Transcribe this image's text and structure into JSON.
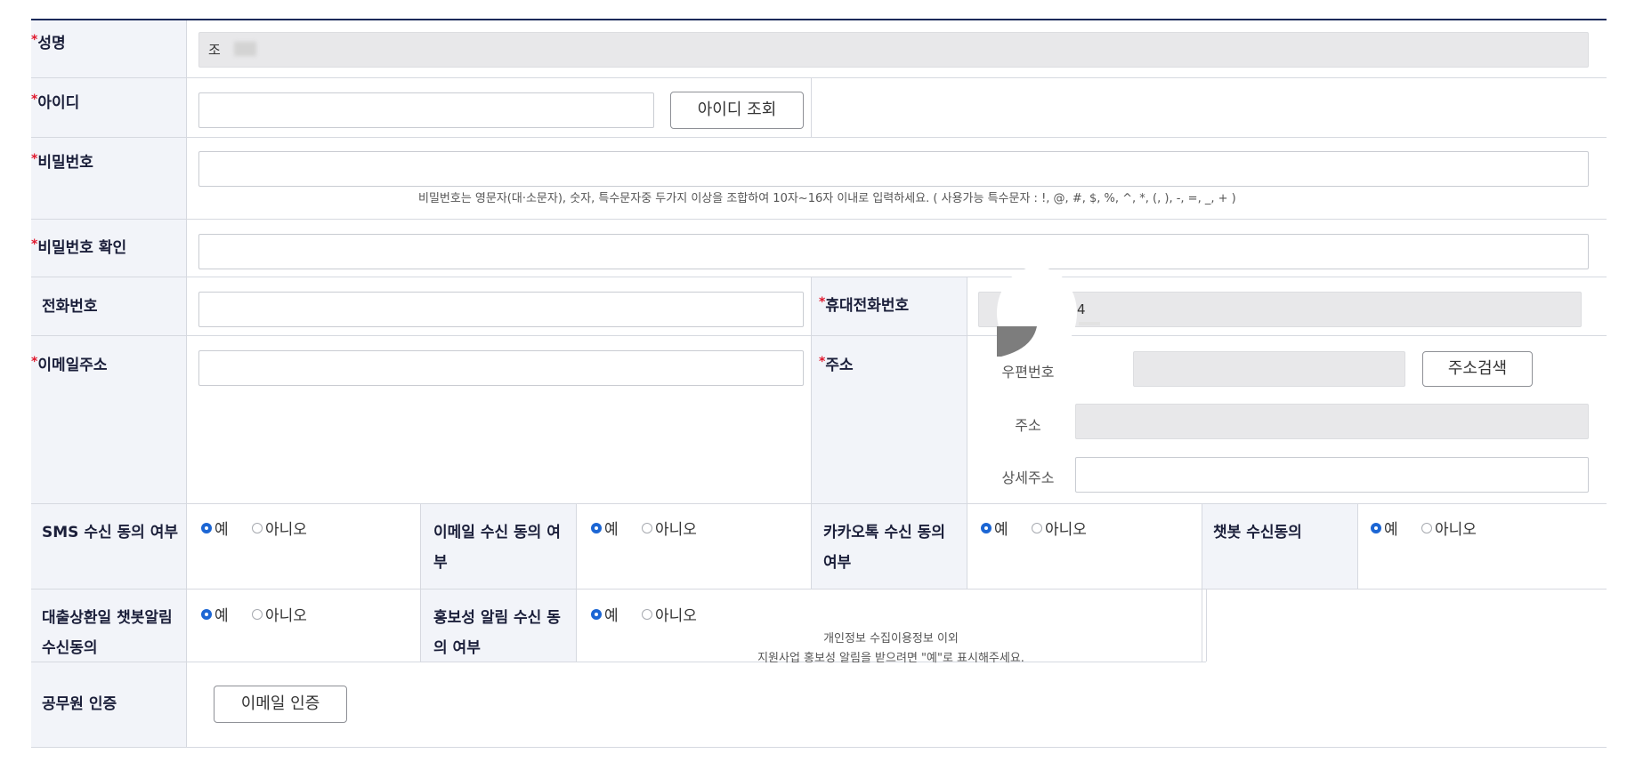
{
  "form": {
    "rows": {
      "name": {
        "label": "성명",
        "required": true,
        "value": "조"
      },
      "user_id": {
        "label": "아이디",
        "required": true,
        "value": "",
        "check_button": "아이디 조회"
      },
      "password": {
        "label": "비밀번호",
        "required": true,
        "value": "",
        "help": "비밀번호는 영문자(대·소문자), 숫자, 특수문자중 두가지 이상을 조합하여 10자~16자 이내로 입력하세요. ( 사용가능 특수문자 : !, @, #, $, %, ^, *, (, ), -, =, _, + )"
      },
      "password_confirm": {
        "label": "비밀번호 확인",
        "required": true,
        "value": ""
      },
      "phone": {
        "label": "전화번호",
        "required": false,
        "value": ""
      },
      "mobile": {
        "label": "휴대전화번호",
        "required": true,
        "value": "4"
      },
      "email": {
        "label": "이메일주소",
        "required": true,
        "value": ""
      },
      "address": {
        "label": "주소",
        "required": true,
        "zip_label": "우편번호",
        "zip_value": "",
        "search_button": "주소검색",
        "addr_label": "주소",
        "addr_value": "",
        "detail_label": "상세주소",
        "detail_value": ""
      },
      "consent_row1": [
        {
          "label": "SMS 수신 동의 여부",
          "yes": "예",
          "no": "아니오",
          "selected": "yes"
        },
        {
          "label": "이메일 수신 동의 여부",
          "yes": "예",
          "no": "아니오",
          "selected": "yes"
        },
        {
          "label": "카카오톡 수신 동의 여부",
          "yes": "예",
          "no": "아니오",
          "selected": "yes"
        },
        {
          "label": "챗봇 수신동의",
          "yes": "예",
          "no": "아니오",
          "selected": "yes"
        }
      ],
      "consent_row2": [
        {
          "label": "대출상환일 챗봇알림 수신동의",
          "yes": "예",
          "no": "아니오",
          "selected": "yes"
        },
        {
          "label": "홍보성 알림 수신 동의 여부",
          "yes": "예",
          "no": "아니오",
          "selected": "yes",
          "note_line1": "개인정보 수집이용정보 이외",
          "note_line2": "지원사업 홍보성 알림을 받으려면 \"예\"로 표시해주세요."
        }
      ],
      "official": {
        "label": "공무원 인증",
        "button": "이메일 인증"
      }
    },
    "required_mark": "*",
    "colors": {
      "accent": "#1c66d4",
      "required": "#e0182d",
      "top_border": "#1a2a5a",
      "label_bg": "#f2f4f9"
    }
  }
}
